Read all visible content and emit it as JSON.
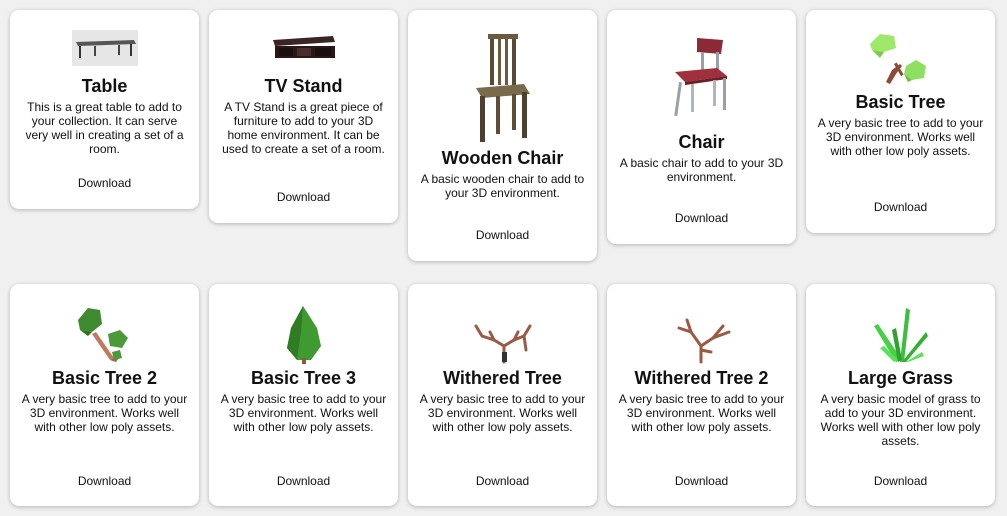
{
  "download_label": "Download",
  "cards": [
    {
      "title": "Table",
      "description": "This is a great table to add to your collection. It can serve very well in creating a set of a room.",
      "icon": "table-icon"
    },
    {
      "title": "TV Stand",
      "description": "A TV Stand is a great piece of furniture to add to your 3D home environment. It can be used to create a set of a room.",
      "icon": "tv-stand-icon"
    },
    {
      "title": "Wooden Chair",
      "description": "A basic wooden chair to add to your 3D environment.",
      "icon": "wooden-chair-icon"
    },
    {
      "title": "Chair",
      "description": "A basic chair to add to your 3D environment.",
      "icon": "chair-icon"
    },
    {
      "title": "Basic Tree",
      "description": "A very basic tree to add to your 3D environment. Works well with other low poly assets.",
      "icon": "basic-tree-icon"
    },
    {
      "title": "Basic Tree 2",
      "description": "A very basic tree to add to your 3D environment. Works well with other low poly assets.",
      "icon": "basic-tree-2-icon"
    },
    {
      "title": "Basic Tree 3",
      "description": "A very basic tree to add to your 3D environment. Works well with other low poly assets.",
      "icon": "basic-tree-3-icon"
    },
    {
      "title": "Withered Tree",
      "description": "A very basic tree to add to your 3D environment. Works well with other low poly assets.",
      "icon": "withered-tree-icon"
    },
    {
      "title": "Withered Tree 2",
      "description": "A very basic tree to add to your 3D environment. Works well with other low poly assets.",
      "icon": "withered-tree-2-icon"
    },
    {
      "title": "Large Grass",
      "description": "A very basic model of grass to add to your 3D environment. Works well with other low poly assets.",
      "icon": "large-grass-icon"
    }
  ]
}
